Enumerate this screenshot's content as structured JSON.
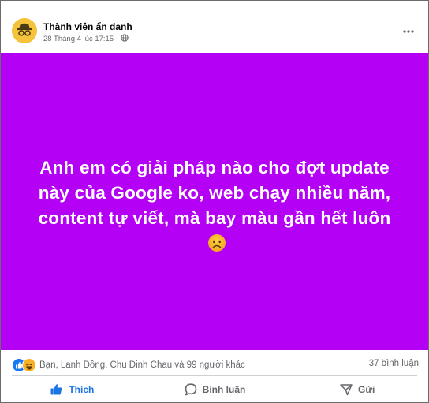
{
  "post": {
    "author": "Thành viên ẩn danh",
    "timestamp": "28 Tháng 4 lúc 17:15",
    "audience_icon": "globe-icon",
    "avatar_icon": "anonymous-incognito-icon",
    "more_icon": "more-options-icon"
  },
  "banner": {
    "background_color": "#b400f4",
    "text_lines": [
      "Anh em có giải pháp nào cho đợt update",
      "này của Google ko, web chạy nhiều năm,",
      "content tự viết, mà bay màu gần hết luôn"
    ],
    "emoji": "disappointed-face-emoji"
  },
  "stats": {
    "reaction_icons": [
      "like-reaction-icon",
      "haha-reaction-icon"
    ],
    "reaction_names": "Bạn, Lanh Đồng, Chu Dinh Chau và 99 người khác",
    "comment_count": "37 bình luận"
  },
  "actions": {
    "like_label": "Thích",
    "comment_label": "Bình luận",
    "share_label": "Gửi"
  },
  "colors": {
    "like_blue": "#1b74e4",
    "muted_text": "#65676b"
  }
}
